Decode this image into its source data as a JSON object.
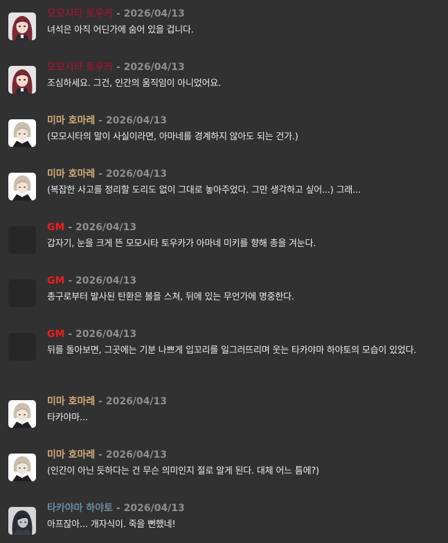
{
  "colors": {
    "background": "#313131",
    "date": "#8e8e8e",
    "text": "#ececec"
  },
  "messages": [
    {
      "speaker": "모모시타 토우카",
      "speaker_color": "#8b1b30",
      "avatar": "momoshita-touka-avatar-icon",
      "separator": "-",
      "date": "2026/04/13",
      "text": "녀석은 아직 어딘가에 숨어 있을 겁니다."
    },
    {
      "speaker": "모모시타 토우카",
      "speaker_color": "#8b1b30",
      "avatar": "momoshita-touka-avatar-icon",
      "separator": "-",
      "date": "2026/04/13",
      "text": "조심하세요. 그건, 인간의 움직임이 아니었어요."
    },
    {
      "speaker": "미마 호마레",
      "speaker_color": "#d2ab7a",
      "avatar": "mima-homare-avatar-icon",
      "separator": "-",
      "date": "2026/04/13",
      "text": "(모모시타의 말이 사실이라면, 아마네를 경계하지 않아도 되는 건가.)"
    },
    {
      "speaker": "미마 호마레",
      "speaker_color": "#d2ab7a",
      "avatar": "mima-homare-avatar-icon",
      "separator": "-",
      "date": "2026/04/13",
      "text": "(복잡한 사고를 정리할 도리도 없이 그대로 놓아주었다. 그만 생각하고 싶어...) 그래..."
    },
    {
      "speaker": "GM",
      "speaker_color": "#ee1d1d",
      "avatar": "blank-avatar-icon",
      "separator": "-",
      "date": "2026/04/13",
      "text": "갑자기, 눈을 크게 뜬 모모시타 토우카가 아마네 미키를 향해 총을 겨눈다."
    },
    {
      "speaker": "GM",
      "speaker_color": "#ee1d1d",
      "avatar": "blank-avatar-icon",
      "separator": "-",
      "date": "2026/04/13",
      "text": "총구로부터 발사된 탄환은 볼을 스쳐, 뒤에 있는 무언가에 명중한다."
    },
    {
      "speaker": "GM",
      "speaker_color": "#ee1d1d",
      "avatar": "blank-avatar-icon",
      "separator": "-",
      "date": "2026/04/13",
      "text": "뒤를 돌아보면, 그곳에는 기분 나쁘게 입꼬리를 일그러뜨리며 웃는 타카야마 하야토의 모습이 있었다."
    },
    {
      "speaker": "미마 호마레",
      "speaker_color": "#d2ab7a",
      "avatar": "mima-homare-avatar-icon",
      "separator": "-",
      "date": "2026/04/13",
      "text": "타카야마..."
    },
    {
      "speaker": "미마 호마레",
      "speaker_color": "#d2ab7a",
      "avatar": "mima-homare-avatar-icon",
      "separator": "-",
      "date": "2026/04/13",
      "text": "(인간이 아닌 듯하다는 건 무슨 의미인지 절로 알게 된다. 대체 어느 틈에?)"
    },
    {
      "speaker": "타카야마 하야토",
      "speaker_color": "#6d8aa1",
      "avatar": "takayama-hayato-avatar-icon",
      "separator": "-",
      "date": "2026/04/13",
      "text": "아프잖아... 개자식이. 죽을 뻔했네!"
    }
  ]
}
